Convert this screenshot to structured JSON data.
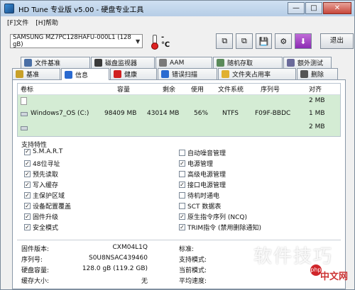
{
  "window": {
    "title": "HD Tune 专业版 v5.00 - 硬盘专业工具",
    "minimize": "—",
    "maximize": "□",
    "close": "✕"
  },
  "menu": [
    {
      "label": "[F]文件"
    },
    {
      "label": "[H]帮助"
    }
  ],
  "toolbar": {
    "drive": "SAMSUNG MZ7PC128HAFU-000L1 (128 gB)",
    "temperature": "- ℃",
    "exit_label": "退出"
  },
  "tabs_row1": [
    {
      "label": "文件基准",
      "icon": "file-benchmark-icon",
      "color": "#4a6fa5"
    },
    {
      "label": "磁盘监视器",
      "icon": "disk-monitor-icon",
      "color": "#3a3a3a"
    },
    {
      "label": "AAM",
      "icon": "speaker-icon",
      "color": "#7a7a7a"
    },
    {
      "label": "随机存取",
      "icon": "random-access-icon",
      "color": "#5a8a5a"
    },
    {
      "label": "额外测试",
      "icon": "extra-tests-icon",
      "color": "#6a6a9a"
    }
  ],
  "tabs_row2": [
    {
      "label": "基准",
      "icon": "benchmark-icon",
      "color": "#c8a028"
    },
    {
      "label": "信息",
      "icon": "info-icon",
      "color": "#2a6ad0",
      "active": true
    },
    {
      "label": "健康",
      "icon": "health-icon",
      "color": "#d02020"
    },
    {
      "label": "错误扫描",
      "icon": "error-scan-icon",
      "color": "#2a6ad0"
    },
    {
      "label": "文件夹占用率",
      "icon": "folder-usage-icon",
      "color": "#e0b030"
    },
    {
      "label": "删除",
      "icon": "erase-icon",
      "color": "#555555"
    }
  ],
  "disk_table": {
    "headers": [
      "卷标",
      "容量",
      "剩余",
      "使用",
      "文件系统",
      "序列号",
      "对齐"
    ],
    "row": {
      "label": "Windows7_OS (C:)",
      "capacity": "98409 MB",
      "free": "43014 MB",
      "used": "56%",
      "filesystem": "NTFS",
      "serial": "F09F-BBDC"
    },
    "alignment": [
      "2 MB",
      "1 MB",
      "2 MB"
    ]
  },
  "features_label": "支持特性",
  "features_left": [
    {
      "label": "S.M.A.R.T",
      "checked": true
    },
    {
      "label": "48位寻址",
      "checked": true
    },
    {
      "label": "预先读取",
      "checked": true
    },
    {
      "label": "写入缓存",
      "checked": true
    },
    {
      "label": "主保护区域",
      "checked": true
    },
    {
      "label": "设备配置覆盖",
      "checked": true
    },
    {
      "label": "固件升级",
      "checked": true
    },
    {
      "label": "安全模式",
      "checked": true
    }
  ],
  "features_right": [
    {
      "label": "自动噪音管理",
      "checked": false
    },
    {
      "label": "电源管理",
      "checked": true
    },
    {
      "label": "高级电源管理",
      "checked": false
    },
    {
      "label": "接口电源管理",
      "checked": true
    },
    {
      "label": "待机时通电",
      "checked": false
    },
    {
      "label": "SCT 数据表",
      "checked": false
    },
    {
      "label": "原生指令序列 (NCQ)",
      "checked": true
    },
    {
      "label": "TRIM指令 (禁用删除通知)",
      "checked": true
    }
  ],
  "info_left": [
    {
      "label": "固件版本:",
      "value": "CXM04L1Q"
    },
    {
      "label": "序列号:",
      "value": "S0U8NSAC439460"
    },
    {
      "label": "硬盘容量:",
      "value": "128.0 gB (119.2 GB)"
    },
    {
      "label": "缓存大小:",
      "value": "无"
    }
  ],
  "info_right": [
    {
      "label": "标准:"
    },
    {
      "label": "支持模式:"
    },
    {
      "label": "当前模式:"
    },
    {
      "label": "平均速度:"
    }
  ],
  "watermark": {
    "text": "软件技巧",
    "logo": "php",
    "site": "中文网"
  }
}
